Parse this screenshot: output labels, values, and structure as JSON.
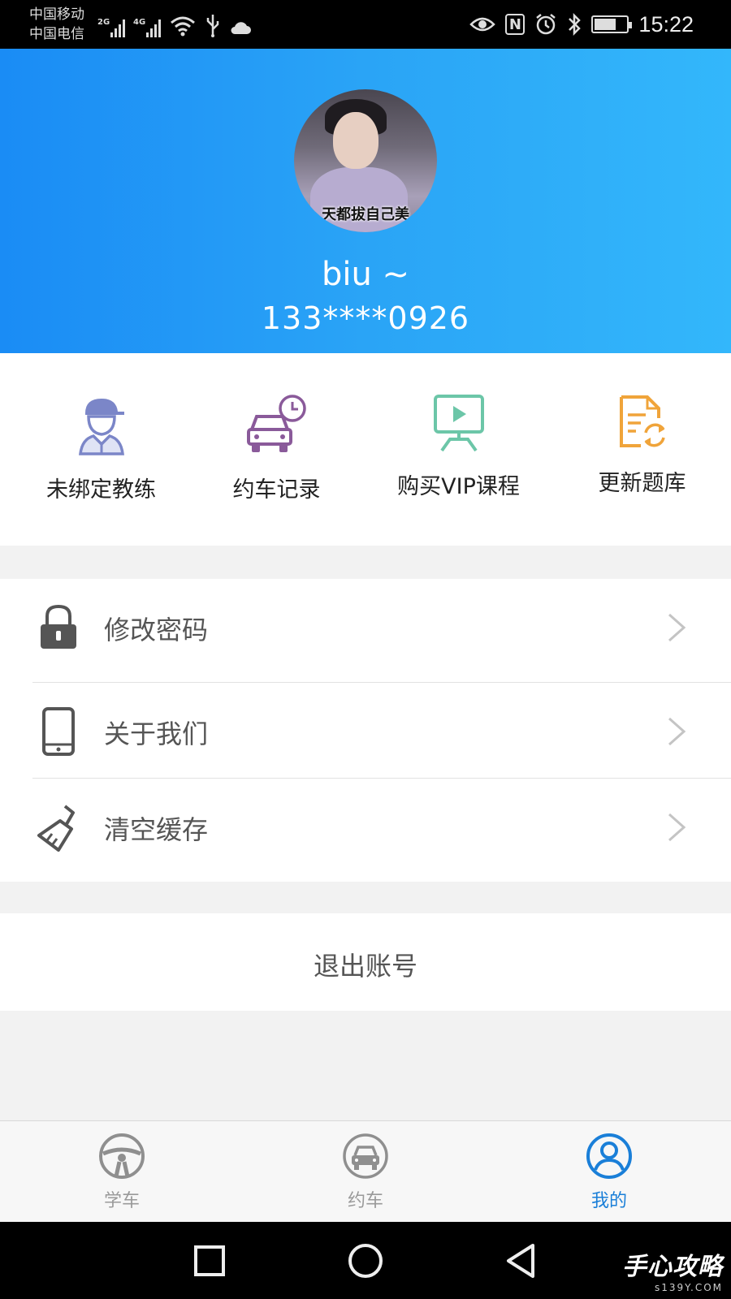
{
  "status_bar": {
    "carrier_1": "中国移动",
    "carrier_2": "中国电信",
    "network_1": "2G",
    "network_2": "4G",
    "time": "15:22",
    "nfc_label": "N"
  },
  "profile": {
    "avatar_caption": "天都拔自己美",
    "username": "biu ~",
    "phone": "133****0926"
  },
  "quick_actions": [
    {
      "label": "未绑定教练",
      "icon": "coach-icon",
      "color": "#7b86c8"
    },
    {
      "label": "约车记录",
      "icon": "car-clock-icon",
      "color": "#8a5a9a"
    },
    {
      "label": "购买VIP课程",
      "icon": "video-screen-icon",
      "color": "#6cc6a8"
    },
    {
      "label": "更新题库",
      "icon": "document-refresh-icon",
      "color": "#f0a43a"
    }
  ],
  "settings": [
    {
      "label": "修改密码",
      "icon": "lock-icon"
    },
    {
      "label": "关于我们",
      "icon": "mobile-phone-icon"
    },
    {
      "label": "清空缓存",
      "icon": "brush-icon"
    }
  ],
  "logout_label": "退出账号",
  "tabs": [
    {
      "label": "学车",
      "icon": "steering-wheel-icon",
      "active": false
    },
    {
      "label": "约车",
      "icon": "car-icon",
      "active": false
    },
    {
      "label": "我的",
      "icon": "user-icon",
      "active": true
    }
  ],
  "watermark": {
    "text": "手心攻略",
    "sub": "s139Y.COM"
  },
  "colors": {
    "header_gradient_start": "#1a8cf5",
    "header_gradient_end": "#33b7fb",
    "active_tab": "#1a7fd8",
    "inactive_tab": "#9a9a9a"
  }
}
